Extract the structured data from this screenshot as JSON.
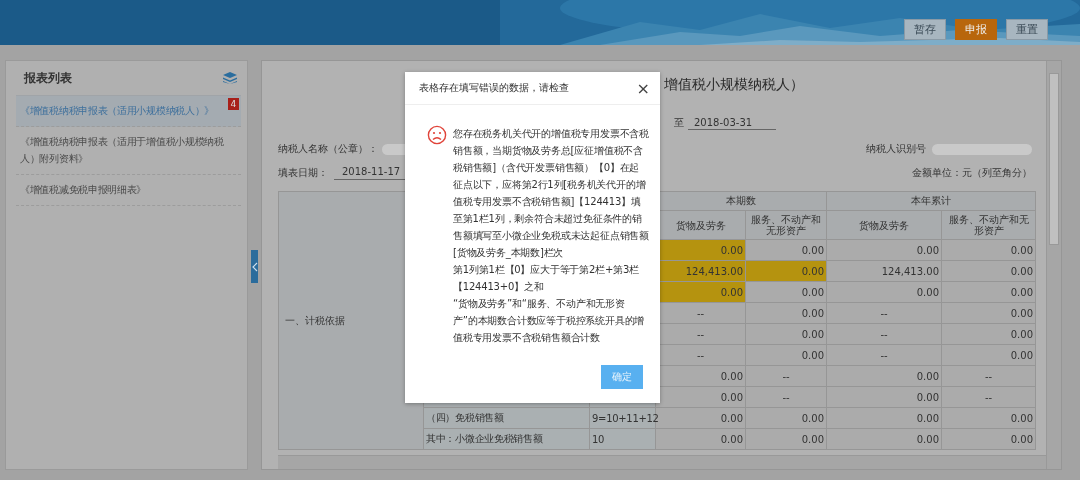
{
  "toolbar": {
    "buttons": [
      {
        "label": "暂存",
        "kind": "plain"
      },
      {
        "label": "申报",
        "kind": "primary"
      },
      {
        "label": "重置",
        "kind": "plain"
      }
    ]
  },
  "sidebar": {
    "title": "报表列表",
    "items": [
      {
        "label": "《增值税纳税申报表（适用小规模纳税人）》",
        "selected": true,
        "badge": "4"
      },
      {
        "label": "《增值税纳税申报表（适用于增值税小规模纳税人）附列资料》",
        "selected": false
      },
      {
        "label": "《增值税减免税申报明细表》",
        "selected": false
      }
    ]
  },
  "form": {
    "title": "增值税小规模纳税人）",
    "period_to_label": "至",
    "period_to": "2018-03-31",
    "taxpayer_name_label": "纳税人名称（公章）：",
    "taxpayer_id_label": "纳税人识别号",
    "fill_date_label": "填表日期：",
    "fill_date": "2018-11-17",
    "unit": "金额单位：元（列至角分）"
  },
  "table": {
    "section_label": "一、计税依据",
    "groups": [
      "本期数",
      "本年累计"
    ],
    "columns": [
      "货物及劳务",
      "服务、不动产和无形资产",
      "货物及劳务",
      "服务、不动产和无形资产"
    ],
    "rows": [
      {
        "cells": [
          {
            "value": "0.00",
            "flagged": true
          },
          {
            "value": "0.00",
            "flagged": false
          },
          {
            "value": "0.00",
            "flagged": false
          },
          {
            "value": "0.00",
            "flagged": false
          }
        ]
      },
      {
        "cells": [
          {
            "value": "124,413.00",
            "flagged": true
          },
          {
            "value": "0.00",
            "flagged": true
          },
          {
            "value": "124,413.00",
            "flagged": false
          },
          {
            "value": "0.00",
            "flagged": false
          }
        ]
      },
      {
        "cells": [
          {
            "value": "0.00",
            "flagged": true
          },
          {
            "value": "0.00",
            "flagged": false
          },
          {
            "value": "0.00",
            "flagged": false
          },
          {
            "value": "0.00",
            "flagged": false
          }
        ]
      },
      {
        "cells": [
          {
            "value": "--",
            "flagged": false
          },
          {
            "value": "0.00",
            "flagged": false
          },
          {
            "value": "--",
            "flagged": false
          },
          {
            "value": "0.00",
            "flagged": false
          }
        ]
      },
      {
        "cells": [
          {
            "value": "--",
            "flagged": false
          },
          {
            "value": "0.00",
            "flagged": false
          },
          {
            "value": "--",
            "flagged": false
          },
          {
            "value": "0.00",
            "flagged": false
          }
        ]
      },
      {
        "cells": [
          {
            "value": "--",
            "flagged": false
          },
          {
            "value": "0.00",
            "flagged": false
          },
          {
            "value": "--",
            "flagged": false
          },
          {
            "value": "0.00",
            "flagged": false
          }
        ]
      },
      {
        "cells": [
          {
            "value": "0.00",
            "flagged": false
          },
          {
            "value": "--",
            "flagged": false
          },
          {
            "value": "0.00",
            "flagged": false
          },
          {
            "value": "--",
            "flagged": false
          }
        ]
      },
      {
        "cells": [
          {
            "value": "0.00",
            "flagged": false
          },
          {
            "value": "--",
            "flagged": false
          },
          {
            "value": "0.00",
            "flagged": false
          },
          {
            "value": "--",
            "flagged": false
          }
        ]
      },
      {
        "label": "（四）免税销售额",
        "line": "9=10+11+12",
        "cells": [
          {
            "value": "0.00",
            "flagged": false
          },
          {
            "value": "0.00",
            "flagged": false
          },
          {
            "value": "0.00",
            "flagged": false
          },
          {
            "value": "0.00",
            "flagged": false
          }
        ]
      },
      {
        "label": "其中：小微企业免税销售额",
        "line": "10",
        "cells": [
          {
            "value": "0.00",
            "flagged": false
          },
          {
            "value": "0.00",
            "flagged": false
          },
          {
            "value": "0.00",
            "flagged": false
          },
          {
            "value": "0.00",
            "flagged": false
          }
        ]
      }
    ]
  },
  "dialog": {
    "title": "表格存在填写错误的数据，请检查",
    "close": "×",
    "paragraphs": [
      "您存在税务机关代开的增值税专用发票不含税销售额，当期货物及劳务总[应征增值税不含税销售额]（含代开发票销售额）【0】在起征点以下，应将第2行1列[税务机关代开的增值税专用发票不含税销售额]【124413】填至第1栏1列，剩余符合未超过免征条件的销售额填写至小微企业免税或未达起征点销售额[货物及劳务_本期数]栏次",
      "第1列第1栏【0】应大于等于第2栏+第3栏【124413+0】之和",
      "“货物及劳务”和“服务、不动产和无形资产”的本期数合计数应等于税控系统开具的增值税专用发票不含税销售额合计数"
    ],
    "confirm": "确定"
  }
}
